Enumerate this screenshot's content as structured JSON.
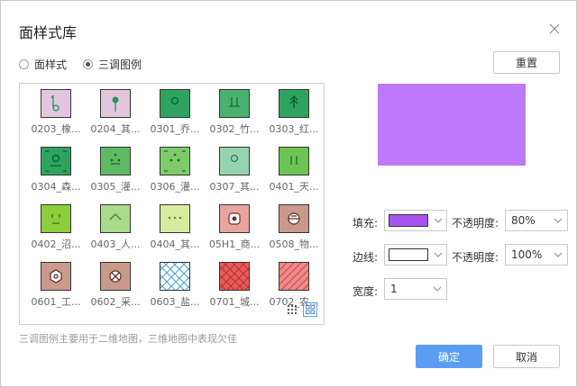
{
  "dialog": {
    "title": "面样式库",
    "close_icon": "close-icon"
  },
  "mode": {
    "options": [
      "面样式",
      "三调图例"
    ],
    "selected": "三调图例"
  },
  "reset_label": "重置",
  "swatches": [
    {
      "label": "0203_橡...",
      "bg": "#e3c6dd",
      "glyph": "#1f9a5a",
      "icon": "hook-pin-icon"
    },
    {
      "label": "0204_其...",
      "bg": "#e3c6dd",
      "glyph": "#1f9a5a",
      "icon": "pin-icon"
    },
    {
      "label": "0301_乔...",
      "bg": "#2ea35f",
      "glyph": "#0c5a32",
      "icon": "circle-icon"
    },
    {
      "label": "0302_竹...",
      "bg": "#49b271",
      "glyph": "#1a6a3d",
      "icon": "bamboo-icon"
    },
    {
      "label": "0303_红...",
      "bg": "#2ea35f",
      "glyph": "#0c5a32",
      "icon": "arrow-tree-icon"
    },
    {
      "label": "0304_森...",
      "bg": "#2ea35f",
      "glyph": "#0c5a32",
      "icon": "forest-icon"
    },
    {
      "label": "0305_灌...",
      "bg": "#5fba62",
      "glyph": "#1a6a3d",
      "icon": "shrub-dots-icon"
    },
    {
      "label": "0306_灌...",
      "bg": "#7fcb6a",
      "glyph": "#1a6a3d",
      "icon": "shrub-icon"
    },
    {
      "label": "0307_其...",
      "bg": "#94d3ad",
      "glyph": "#2a7a4d",
      "icon": "circle-icon"
    },
    {
      "label": "0401_天...",
      "bg": "#6cc452",
      "glyph": "#1a6a3d",
      "icon": "grass-icon"
    },
    {
      "label": "0402_沼...",
      "bg": "#8bcf3c",
      "glyph": "#3f6a10",
      "icon": "marsh-icon"
    },
    {
      "label": "0403_人...",
      "bg": "#a9dc8a",
      "glyph": "#3f7a30",
      "icon": "chevron-up-icon"
    },
    {
      "label": "0404_其...",
      "bg": "#d6eba0",
      "glyph": "#6a8a30",
      "icon": "dots-icon"
    },
    {
      "label": "05H1_商...",
      "bg": "#e8a59f",
      "glyph": "#7a2a2a",
      "icon": "target-icon"
    },
    {
      "label": "0508_物...",
      "bg": "#c99a8c",
      "glyph": "#5a2a20",
      "icon": "crossed-circle-icon"
    },
    {
      "label": "0601_工...",
      "bg": "#c99a8c",
      "glyph": "#5a2a20",
      "icon": "hexagon-icon"
    },
    {
      "label": "0602_采...",
      "bg": "#c99a8c",
      "glyph": "#5a2a20",
      "icon": "cross-tools-icon"
    },
    {
      "label": "0603_盐...",
      "bg": "#ffffff",
      "glyph": "#3aa0d8",
      "icon": "crosshatch-icon"
    },
    {
      "label": "0701_城...",
      "bg": "#e85a5a",
      "glyph": "#b83030",
      "icon": "crosshatch-icon"
    },
    {
      "label": "0702_农...",
      "bg": "#f08a8a",
      "glyph": "#c04848",
      "icon": "diagonal-hatch-icon"
    }
  ],
  "view_toggle": {
    "list_icon": "small-grid-icon",
    "grid_icon": "large-grid-icon",
    "active": "grid"
  },
  "hint": "三调图例主要用于二维地图，三维地图中表现欠佳",
  "preview": {
    "fill_color": "#be78fa"
  },
  "fill": {
    "label": "填充:",
    "color": "#a855f0",
    "opacity_label": "不透明度:",
    "opacity": "80%"
  },
  "stroke": {
    "label": "边线:",
    "color": "#ffffff",
    "opacity_label": "不透明度:",
    "opacity": "100%"
  },
  "width": {
    "label": "宽度:",
    "value": "1"
  },
  "buttons": {
    "ok": "确定",
    "cancel": "取消"
  }
}
